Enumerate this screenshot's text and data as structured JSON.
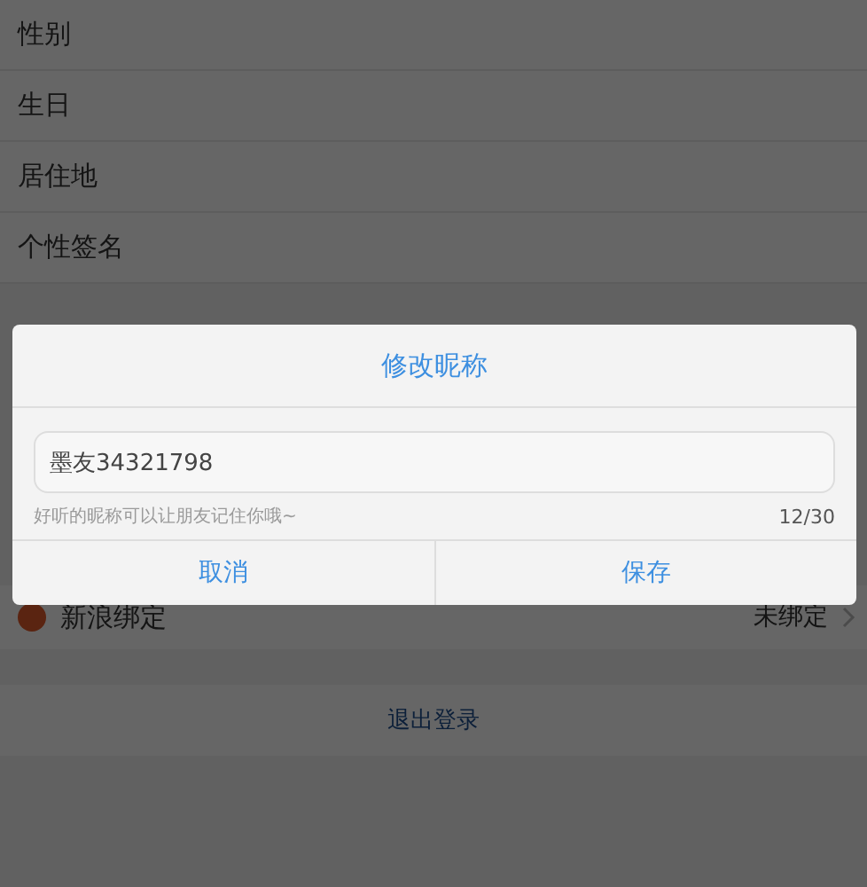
{
  "profile_rows": [
    {
      "label": "性别"
    },
    {
      "label": "生日"
    },
    {
      "label": "居住地"
    },
    {
      "label": "个性签名"
    }
  ],
  "binding_row": {
    "label": "新浪绑定",
    "status": "未绑定"
  },
  "logout": "退出登录",
  "dialog": {
    "title": "修改昵称",
    "value": "墨友34321798",
    "hint": "好听的昵称可以让朋友记住你哦~",
    "counter": "12/30",
    "buttons": [
      {
        "label": "取消"
      },
      {
        "label": "保存"
      }
    ]
  }
}
